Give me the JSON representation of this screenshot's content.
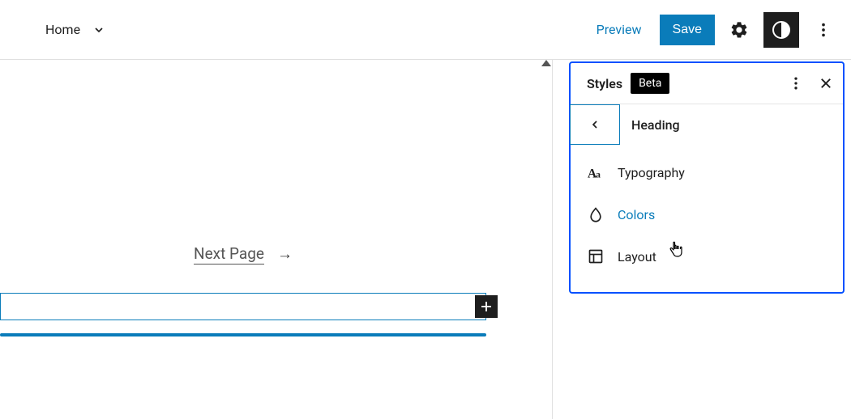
{
  "topbar": {
    "home_label": "Home",
    "preview_label": "Preview",
    "save_label": "Save"
  },
  "editor": {
    "next_page_label": "Next Page"
  },
  "styles": {
    "title": "Styles",
    "badge": "Beta",
    "heading": "Heading",
    "items": [
      {
        "label": "Typography"
      },
      {
        "label": "Colors"
      },
      {
        "label": "Layout"
      }
    ]
  }
}
